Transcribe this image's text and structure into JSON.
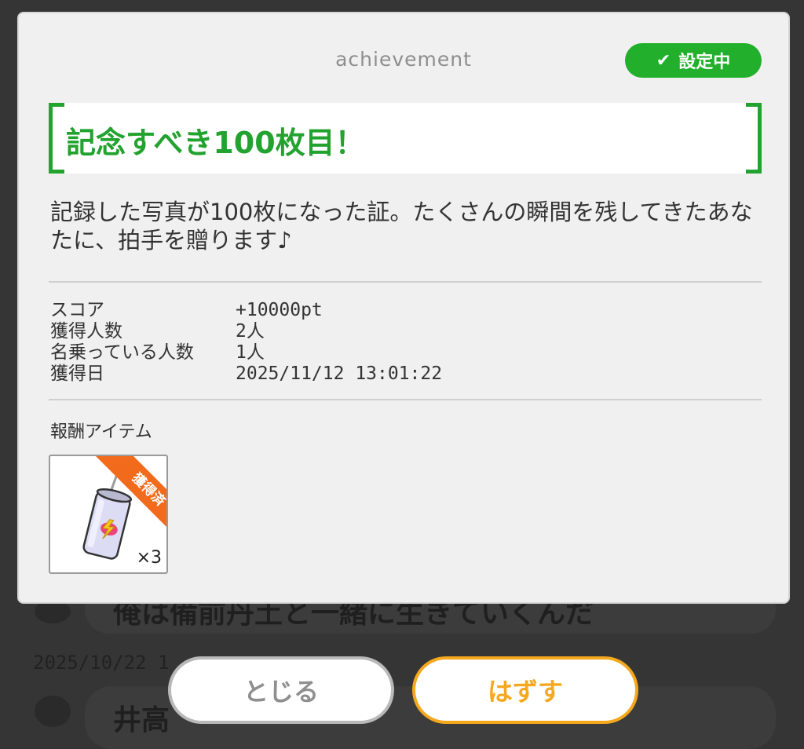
{
  "background": {
    "partial_text_1": "俺は備前丹土と一緒に生きていくんだ",
    "date": "2025/10/22 1",
    "partial_text_2": "井高"
  },
  "modal": {
    "label": "achievement",
    "status_badge": "設定中",
    "title": "記念すべき100枚目！",
    "description": "記録した写真が100枚になった証。たくさんの瞬間を残してきたあなたに、拍手を贈ります♪",
    "stats": [
      {
        "label": "スコア",
        "value": "+10000pt"
      },
      {
        "label": "獲得人数",
        "value": "2人"
      },
      {
        "label": "名乗っている人数",
        "value": "1人"
      },
      {
        "label": "獲得日",
        "value": "2025/11/12 13:01:22"
      }
    ],
    "reward_heading": "報酬アイテム",
    "reward_item": {
      "icon": "energy-drink-can-icon",
      "ribbon": "獲得済",
      "quantity": "×3"
    }
  },
  "buttons": {
    "close": "とじる",
    "remove": "はずす"
  },
  "colors": {
    "accent_green": "#22a22e",
    "badge_green": "#22b02c",
    "ribbon_orange": "#f26a1b",
    "button_orange": "#f5a81e"
  }
}
